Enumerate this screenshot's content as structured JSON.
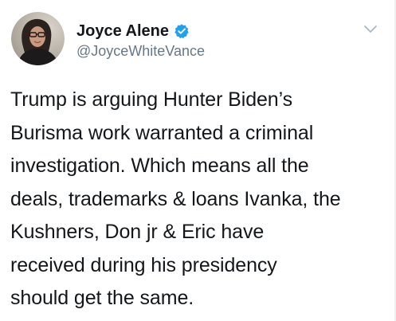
{
  "author": {
    "display_name": "Joyce Alene",
    "handle": "@JoyceWhiteVance",
    "verified": true,
    "avatar_icon": "profile-photo"
  },
  "tweet": {
    "text": "Trump is arguing Hunter Biden’s\nBurisma work warranted a criminal\ninvestigation. Which means all the\ndeals, trademarks & loans Ivanka, the\nKushners, Don jr & Eric have\nreceived during his presidency\nshould get the same."
  },
  "colors": {
    "verified_badge": "#1da1f2",
    "handle": "#657786",
    "text": "#14171a",
    "caret": "#aab8c2"
  },
  "icons": {
    "verified": "verified-badge-icon",
    "menu": "chevron-down-icon"
  }
}
